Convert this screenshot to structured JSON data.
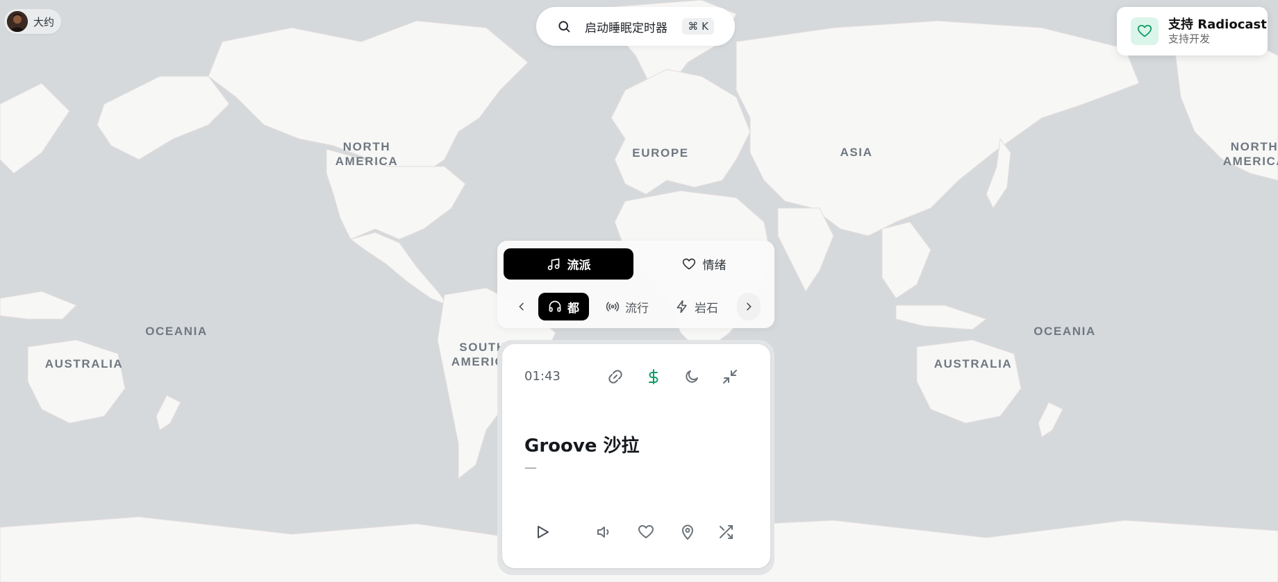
{
  "user": {
    "name": "大约"
  },
  "search": {
    "text": "启动睡眠定时器",
    "shortcut": "⌘ K"
  },
  "support": {
    "title": "支持 Radiocast",
    "subtitle": "支持开发",
    "accent": "#0f9d68"
  },
  "map": {
    "labels": [
      {
        "name": "label-north-america",
        "text": "NORTH\nAMERICA"
      },
      {
        "name": "label-europe",
        "text": "EUROPE"
      },
      {
        "name": "label-asia",
        "text": "ASIA"
      },
      {
        "name": "label-north-america-right",
        "text": "NORTH\nAMERICA"
      },
      {
        "name": "label-oceania-left",
        "text": "OCEANIA"
      },
      {
        "name": "label-australia-left",
        "text": "AUSTRALIA"
      },
      {
        "name": "label-south-america",
        "text": "SOUTH\nAMERICA"
      },
      {
        "name": "label-oceania-right",
        "text": "OCEANIA"
      },
      {
        "name": "label-australia-right",
        "text": "AUSTRALIA"
      }
    ]
  },
  "panel": {
    "tabs": [
      {
        "label": "流派",
        "icon": "music-note-icon",
        "active": true
      },
      {
        "label": "情绪",
        "icon": "heart-icon",
        "active": false
      }
    ],
    "chips": [
      {
        "label": "都",
        "icon": "headphones-icon",
        "active": true
      },
      {
        "label": "流行",
        "icon": "radio-waves-icon",
        "active": false
      },
      {
        "label": "岩石",
        "icon": "lightning-icon",
        "active": false
      }
    ]
  },
  "player": {
    "timer": "01:43",
    "station_title": "Groove 沙拉",
    "station_subtitle": "—",
    "accent": "#0f9d68"
  }
}
